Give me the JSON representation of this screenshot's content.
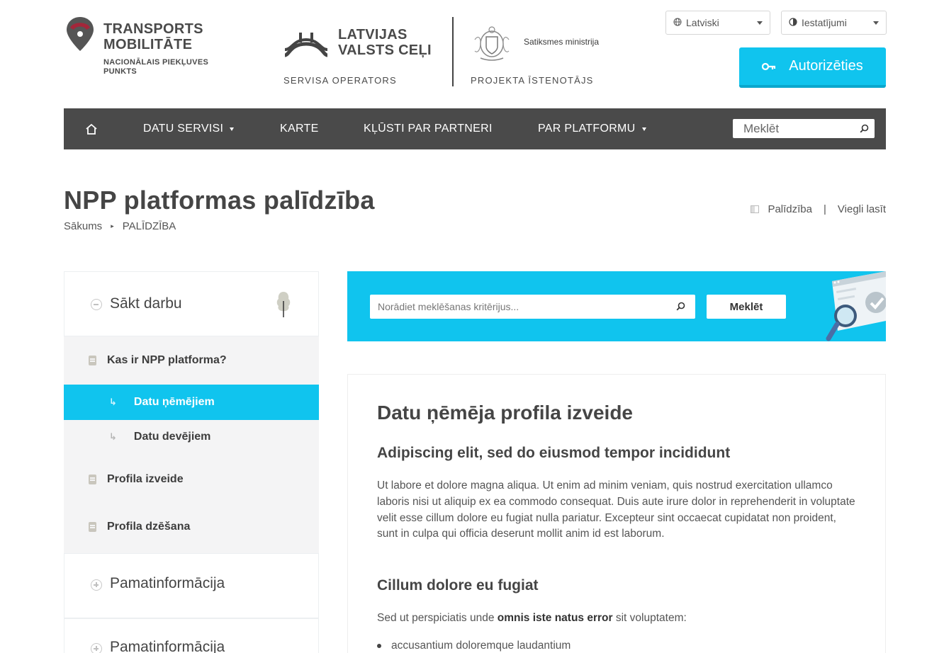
{
  "header": {
    "brand": {
      "line1": "TRANSPORTS",
      "line2": "MOBILITĀTE",
      "sub1": "NACIONĀLAIS PIEKĻUVES",
      "sub2": "PUNKTS"
    },
    "operator": {
      "name1": "LATVIJAS",
      "name2": "VALSTS CEĻI",
      "role": "SERVISA OPERATORS"
    },
    "ministry": {
      "name": "Satiksmes ministrija",
      "role": "PROJEKTA ĪSTENOTĀJS"
    },
    "language_select": "Latviski",
    "settings_select": "Iestatījumi",
    "auth_button": "Autorizēties"
  },
  "nav": {
    "items": [
      "DATU SERVISI",
      "KARTE",
      "KĻŪSTI PAR PARTNERI",
      "PAR PLATFORMU"
    ],
    "search_placeholder": "Meklēt"
  },
  "page": {
    "title": "NPP platformas palīdzība",
    "breadcrumb": [
      "Sākums",
      "PALĪDZĪBA"
    ],
    "tools": [
      "Palīdzība",
      "Viegli lasīt"
    ]
  },
  "sidebar": {
    "sections": [
      "Sākt darbu",
      "Pamatinformācija",
      "Pamatinformācija"
    ],
    "items": [
      "Kas ir NPP platforma?",
      "Datu ņēmējiem",
      "Datu devējiem",
      "Profila izveide",
      "Profila dzēšana"
    ]
  },
  "search": {
    "placeholder": "Norādiet meklēšanas kritērijus...",
    "button": "Meklēt"
  },
  "article": {
    "title": "Datu ņēmēja profila izveide",
    "subtitle1": "Adipiscing elit, sed do eiusmod tempor incididunt",
    "paragraph1": "Ut labore et dolore magna aliqua. Ut enim ad minim veniam, quis nostrud exercitation ullamco laboris nisi ut aliquip ex ea commodo consequat. Duis aute irure dolor in reprehenderit in voluptate velit esse cillum dolore eu fugiat nulla pariatur. Excepteur sint occaecat cupidatat non proident, sunt in culpa qui officia deserunt mollit anim id est laborum.",
    "subtitle2": "Cillum dolore eu fugiat",
    "paragraph2_pre": "Sed ut perspiciatis unde ",
    "paragraph2_bold": "omnis iste natus error",
    "paragraph2_post": " sit voluptatem:",
    "list_item1": "accusantium doloremque laudantium"
  },
  "colors": {
    "accent": "#10c4ee",
    "nav_bg": "#4a4a4a",
    "logo_red": "#9b2335",
    "text_dark": "#454545"
  }
}
